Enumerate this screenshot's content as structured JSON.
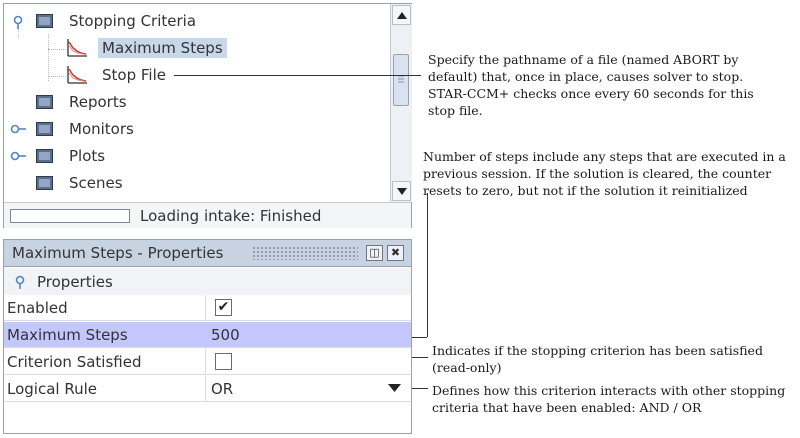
{
  "tree": {
    "items": [
      {
        "label": "Stopping Criteria",
        "kind": "folder",
        "expanded": true
      },
      {
        "label": "Maximum Steps",
        "kind": "chart",
        "selected": true
      },
      {
        "label": "Stop File",
        "kind": "chart"
      },
      {
        "label": "Reports",
        "kind": "folder"
      },
      {
        "label": "Monitors",
        "kind": "folder",
        "expandable": true
      },
      {
        "label": "Plots",
        "kind": "folder",
        "expandable": true
      },
      {
        "label": "Scenes",
        "kind": "folder"
      }
    ],
    "icons": {
      "folder": "folder-icon",
      "chart": "chart-icon",
      "expander": "expander-knob-icon"
    }
  },
  "status": {
    "text": "Loading intake: Finished",
    "progress": 0
  },
  "properties": {
    "title": "Maximum Steps - Properties",
    "group_label": "Properties",
    "rows": [
      {
        "name": "Enabled",
        "type": "checkbox",
        "checked": true,
        "check_glyph": "✔"
      },
      {
        "name": "Maximum Steps",
        "type": "text",
        "value": "500"
      },
      {
        "name": "Criterion Satisfied",
        "type": "checkbox",
        "checked": false,
        "check_glyph": ""
      },
      {
        "name": "Logical Rule",
        "type": "dropdown",
        "value": "OR"
      }
    ],
    "title_buttons": {
      "restore": "◫",
      "close": "✖"
    }
  },
  "callouts": {
    "stop_file": "Specify the pathname of a file (named ABORT by default) that, once in place, causes  solver to stop. STAR-CCM+ checks once every 60 seconds for this stop file.",
    "max_steps": "Number of steps include any steps that are executed in a previous session. If the solution is cleared, the counter resets to zero, but not if the solution it reinitialized",
    "criterion_satisfied": "Indicates if the stopping criterion has been satisfied (read-only)",
    "logical_rule": "Defines how this criterion interacts with other stopping criteria that have been enabled: AND / OR"
  },
  "colors": {
    "selection_tree": "#c9d7ea",
    "selection_row": "#c3c6ff",
    "title_bar": "#c8d3e2"
  }
}
